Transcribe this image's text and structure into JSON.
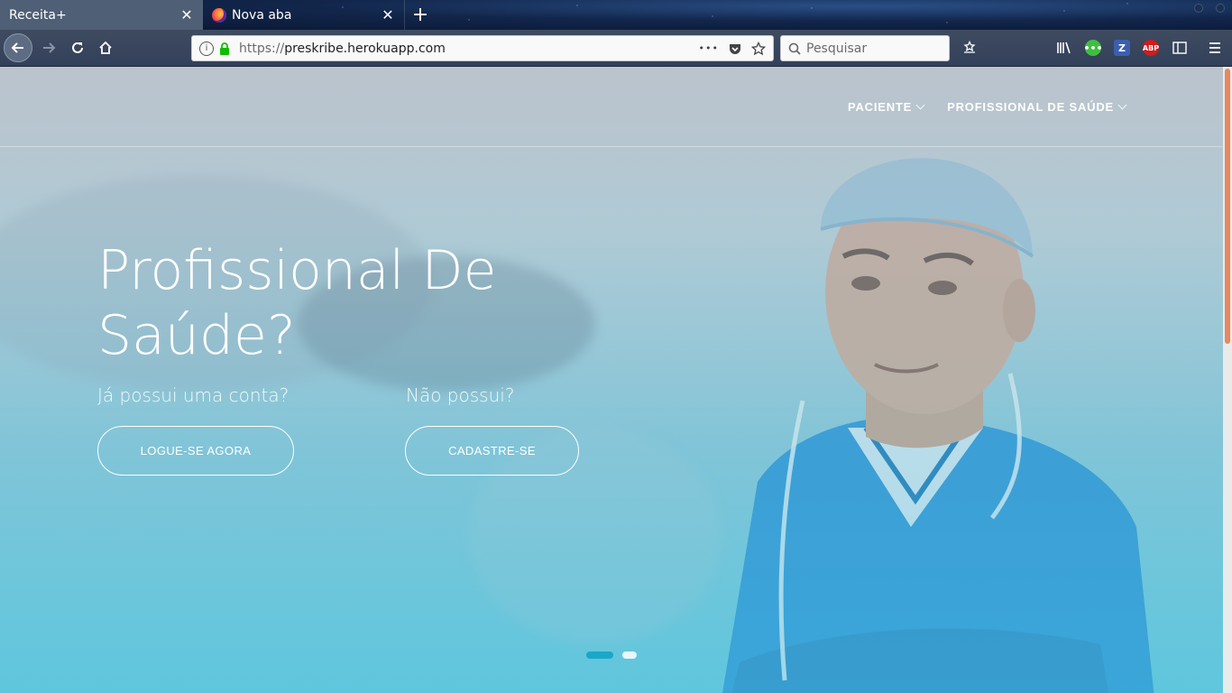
{
  "browser": {
    "tabs": [
      {
        "title": "Receita+",
        "active": true
      },
      {
        "title": "Nova aba",
        "active": false
      }
    ],
    "url": {
      "protocol": "https://",
      "host": "preskribe.herokuapp.com"
    },
    "search_placeholder": "Pesquisar",
    "url_actions": {
      "more": "•••"
    }
  },
  "site": {
    "nav": [
      {
        "label": "PACIENTE"
      },
      {
        "label": "PROFISSIONAL DE SAÚDE"
      }
    ],
    "hero": {
      "title": "Profissional De Saúde?",
      "login_prompt": "Já possui uma conta?",
      "login_button": "LOGUE-SE AGORA",
      "signup_prompt": "Não possui?",
      "signup_button": "CADASTRE-SE"
    },
    "carousel": {
      "slides": 2,
      "active": 1
    }
  },
  "colors": {
    "accent": "#1aa7c8",
    "scroll_thumb": "#e8885f",
    "chrome": "#3e4b60"
  }
}
